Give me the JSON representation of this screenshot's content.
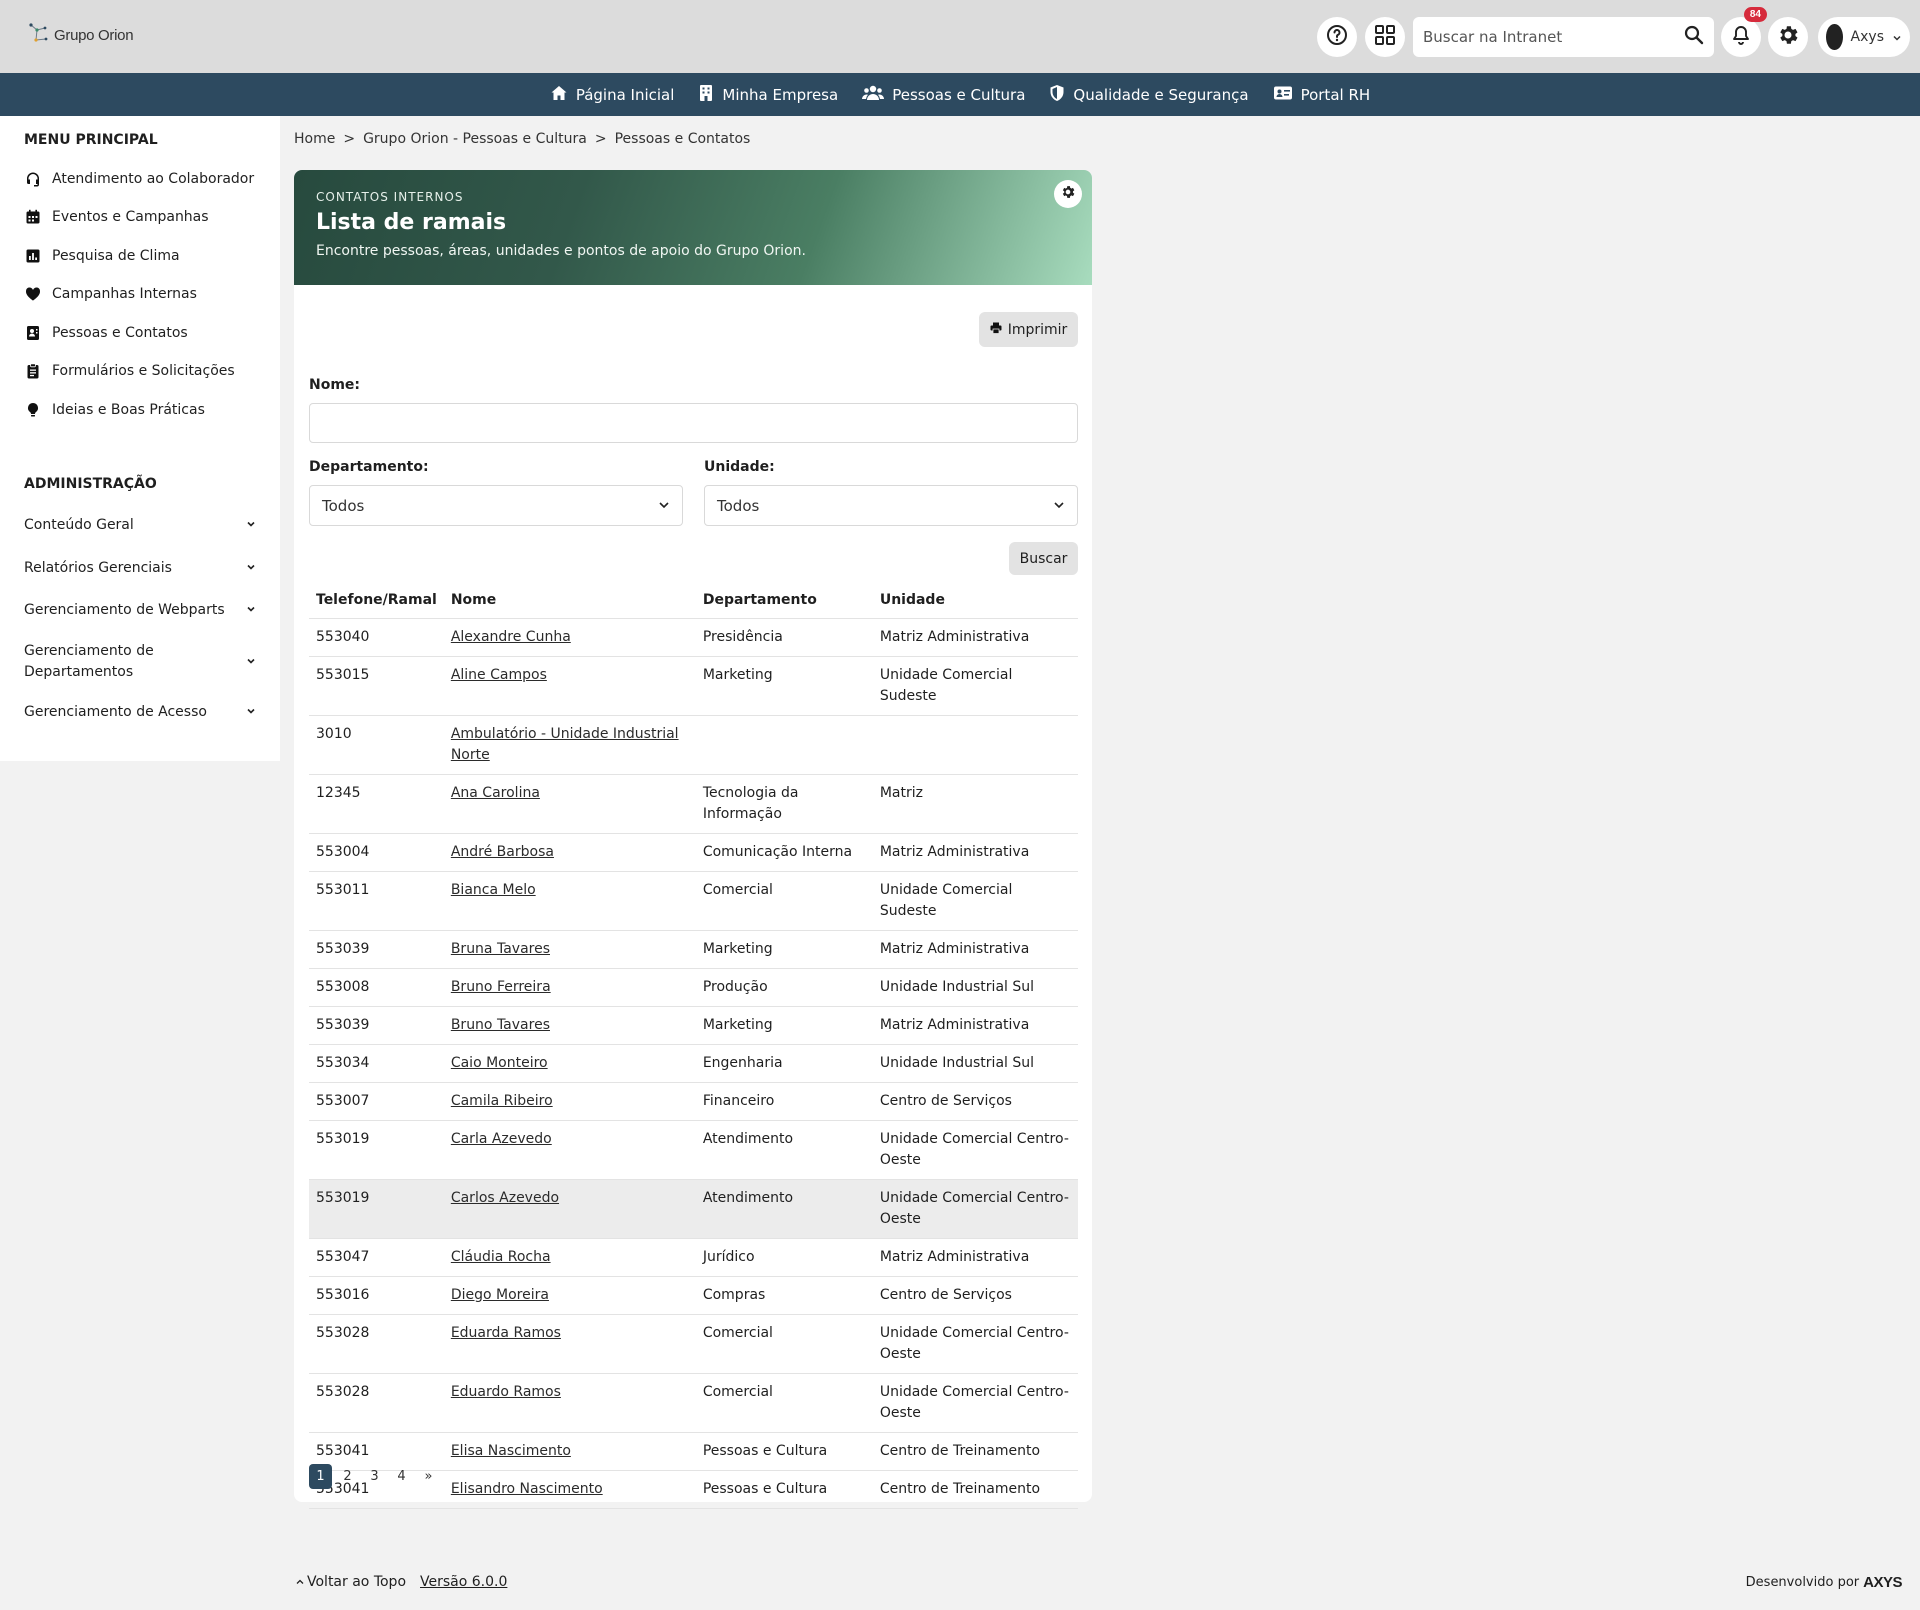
{
  "header": {
    "logo_text": "Grupo Orion",
    "search_placeholder": "Buscar na Intranet",
    "notifications_count": "84",
    "user_name": "Axys"
  },
  "nav": [
    {
      "label": "Página Inicial",
      "icon": "home-icon"
    },
    {
      "label": "Minha Empresa",
      "icon": "building-icon"
    },
    {
      "label": "Pessoas e Cultura",
      "icon": "people-icon"
    },
    {
      "label": "Qualidade e Segurança",
      "icon": "shield-icon"
    },
    {
      "label": "Portal RH",
      "icon": "id-card-icon"
    }
  ],
  "sidebar": {
    "main_heading": "MENU PRINCIPAL",
    "items": [
      {
        "label": "Atendimento ao Colaborador",
        "icon": "headset-icon"
      },
      {
        "label": "Eventos e Campanhas",
        "icon": "calendar-icon"
      },
      {
        "label": "Pesquisa de Clima",
        "icon": "bar-chart-icon"
      },
      {
        "label": "Campanhas Internas",
        "icon": "heart-icon"
      },
      {
        "label": "Pessoas e Contatos",
        "icon": "contact-card-icon"
      },
      {
        "label": "Formulários e Solicitações",
        "icon": "clipboard-icon"
      },
      {
        "label": "Ideias e Boas Práticas",
        "icon": "lightbulb-icon"
      }
    ],
    "admin_heading": "ADMINISTRAÇÃO",
    "admin_items": [
      {
        "label": "Conteúdo Geral"
      },
      {
        "label": "Relatórios Gerenciais"
      },
      {
        "label": "Gerenciamento de Webparts"
      },
      {
        "label": "Gerenciamento de Departamentos"
      },
      {
        "label": "Gerenciamento de Acesso"
      }
    ]
  },
  "breadcrumb": [
    "Home",
    "Grupo Orion - Pessoas e Cultura",
    "Pessoas e Contatos"
  ],
  "breadcrumb_separator": ">",
  "hero": {
    "kicker": "CONTATOS INTERNOS",
    "title": "Lista de ramais",
    "subtitle": "Encontre pessoas, áreas, unidades e pontos de apoio do Grupo Orion."
  },
  "form": {
    "print_label": "Imprimir",
    "name_label": "Nome:",
    "name_value": "",
    "department_label": "Departamento:",
    "department_value": "Todos",
    "unit_label": "Unidade:",
    "unit_value": "Todos",
    "search_label": "Buscar"
  },
  "table": {
    "headers": [
      "Telefone/Ramal",
      "Nome",
      "Departamento",
      "Unidade"
    ],
    "rows": [
      [
        "553040",
        "Alexandre Cunha",
        "Presidência",
        "Matriz Administrativa"
      ],
      [
        "553015",
        "Aline Campos",
        "Marketing",
        "Unidade Comercial Sudeste"
      ],
      [
        "3010",
        "Ambulatório - Unidade Industrial Norte",
        "",
        ""
      ],
      [
        "12345",
        "Ana Carolina",
        "Tecnologia da Informação",
        "Matriz"
      ],
      [
        "553004",
        "André Barbosa",
        "Comunicação Interna",
        "Matriz Administrativa"
      ],
      [
        "553011",
        "Bianca Melo",
        "Comercial",
        "Unidade Comercial Sudeste"
      ],
      [
        "553039",
        "Bruna Tavares",
        "Marketing",
        "Matriz Administrativa"
      ],
      [
        "553008",
        "Bruno Ferreira",
        "Produção",
        "Unidade Industrial Sul"
      ],
      [
        "553039",
        "Bruno Tavares",
        "Marketing",
        "Matriz Administrativa"
      ],
      [
        "553034",
        "Caio Monteiro",
        "Engenharia",
        "Unidade Industrial Sul"
      ],
      [
        "553007",
        "Camila Ribeiro",
        "Financeiro",
        "Centro de Serviços"
      ],
      [
        "553019",
        "Carla Azevedo",
        "Atendimento",
        "Unidade Comercial Centro-Oeste"
      ],
      [
        "553019",
        "Carlos Azevedo",
        "Atendimento",
        "Unidade Comercial Centro-Oeste"
      ],
      [
        "553047",
        "Cláudia Rocha",
        "Jurídico",
        "Matriz Administrativa"
      ],
      [
        "553016",
        "Diego Moreira",
        "Compras",
        "Centro de Serviços"
      ],
      [
        "553028",
        "Eduarda Ramos",
        "Comercial",
        "Unidade Comercial Centro-Oeste"
      ],
      [
        "553028",
        "Eduardo Ramos",
        "Comercial",
        "Unidade Comercial Centro-Oeste"
      ],
      [
        "553041",
        "Elisa Nascimento",
        "Pessoas e Cultura",
        "Centro de Treinamento"
      ],
      [
        "553041",
        "Elisandro Nascimento",
        "Pessoas e Cultura",
        "Centro de Treinamento"
      ]
    ],
    "highlighted_row": 12
  },
  "pagination": {
    "pages": [
      "1",
      "2",
      "3",
      "4"
    ],
    "current": "1",
    "next": "»"
  },
  "footer": {
    "back_to_top": "Voltar ao Topo",
    "version": "Versão 6.0.0",
    "developed_by": "Desenvolvido por",
    "brand": "AXYS"
  },
  "colors": {
    "nav_bg": "#2d4a60",
    "badge": "#d62b3c",
    "hero_start": "#274a3e",
    "hero_end": "#a8dcbe"
  }
}
